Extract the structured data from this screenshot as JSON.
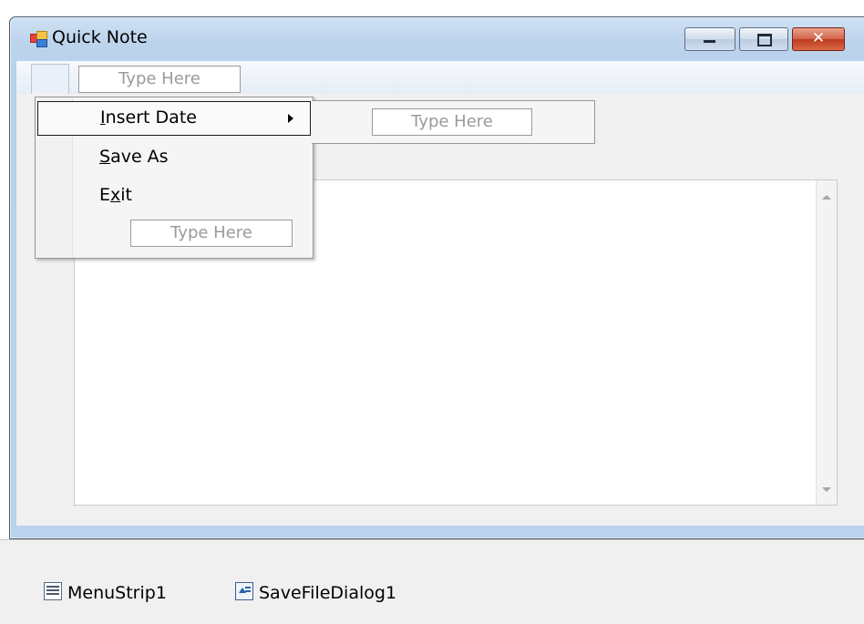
{
  "window": {
    "title": "Quick Note",
    "minimize_glyph": "",
    "maximize_glyph": "",
    "close_glyph": "✕"
  },
  "menustrip": {
    "top_placeholder": "Type Here"
  },
  "dropdown": {
    "items": [
      {
        "prefix": "",
        "mnemonic": "I",
        "rest": "nsert Date"
      },
      {
        "prefix": "",
        "mnemonic": "S",
        "rest": "ave As"
      },
      {
        "prefix": "E",
        "mnemonic": "x",
        "rest": "it"
      }
    ],
    "placeholder": "Type Here"
  },
  "submenu": {
    "placeholder": "Type Here"
  },
  "tray": {
    "items": [
      {
        "label": "MenuStrip1",
        "icon": "menustrip-icon"
      },
      {
        "label": "SaveFileDialog1",
        "icon": "savefiledialog-icon"
      }
    ]
  }
}
